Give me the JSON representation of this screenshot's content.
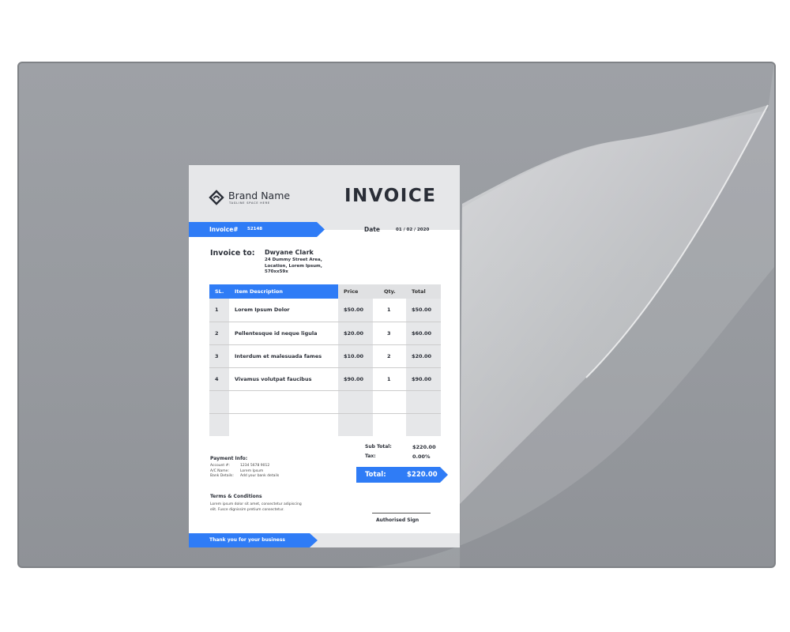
{
  "brand": {
    "name": "Brand Name",
    "tagline": "TAGLINE SPACE HERE"
  },
  "title": "INVOICE",
  "invoice_no_label": "Invoice#",
  "invoice_no": "52148",
  "date_label": "Date",
  "date": "01 / 02 / 2020",
  "to_label": "Invoice to:",
  "client": {
    "name": "Dwyane Clark",
    "address": [
      "24 Dummy Street Area,",
      "Location, Lorem Ipsum,",
      "570xx59x"
    ]
  },
  "table": {
    "headers": [
      "SL.",
      "Item Description",
      "Price",
      "Qty.",
      "Total"
    ],
    "rows": [
      [
        "1",
        "Lorem Ipsum Dolor",
        "$50.00",
        "1",
        "$50.00"
      ],
      [
        "2",
        "Pellentesque id neque ligula",
        "$20.00",
        "3",
        "$60.00"
      ],
      [
        "3",
        "Interdum et malesuada fames",
        "$10.00",
        "2",
        "$20.00"
      ],
      [
        "4",
        "Vivamus volutpat faucibus",
        "$90.00",
        "1",
        "$90.00"
      ]
    ]
  },
  "summary": {
    "sub_total_label": "Sub Total:",
    "sub_total": "$220.00",
    "tax_label": "Tax:",
    "tax": "0.00%",
    "total_label": "Total:",
    "total": "$220.00"
  },
  "payment": {
    "title": "Payment Info:",
    "lines": [
      [
        "Account #:",
        "1234 5678 9012"
      ],
      [
        "A/C Name:",
        "Lorem Ipsum"
      ],
      [
        "Bank Details:",
        "Add your bank details"
      ]
    ]
  },
  "terms": {
    "title": "Terms & Conditions",
    "text": [
      "Lorem ipsum dolor sit amet, consectetur adipiscing",
      "elit. Fusce dignissim pretium consectetur."
    ]
  },
  "sign_label": "Authorised Sign",
  "footer": "Thank you for your business",
  "colors": {
    "accent": "#2f7cf6",
    "mat": "#9a9da2"
  }
}
